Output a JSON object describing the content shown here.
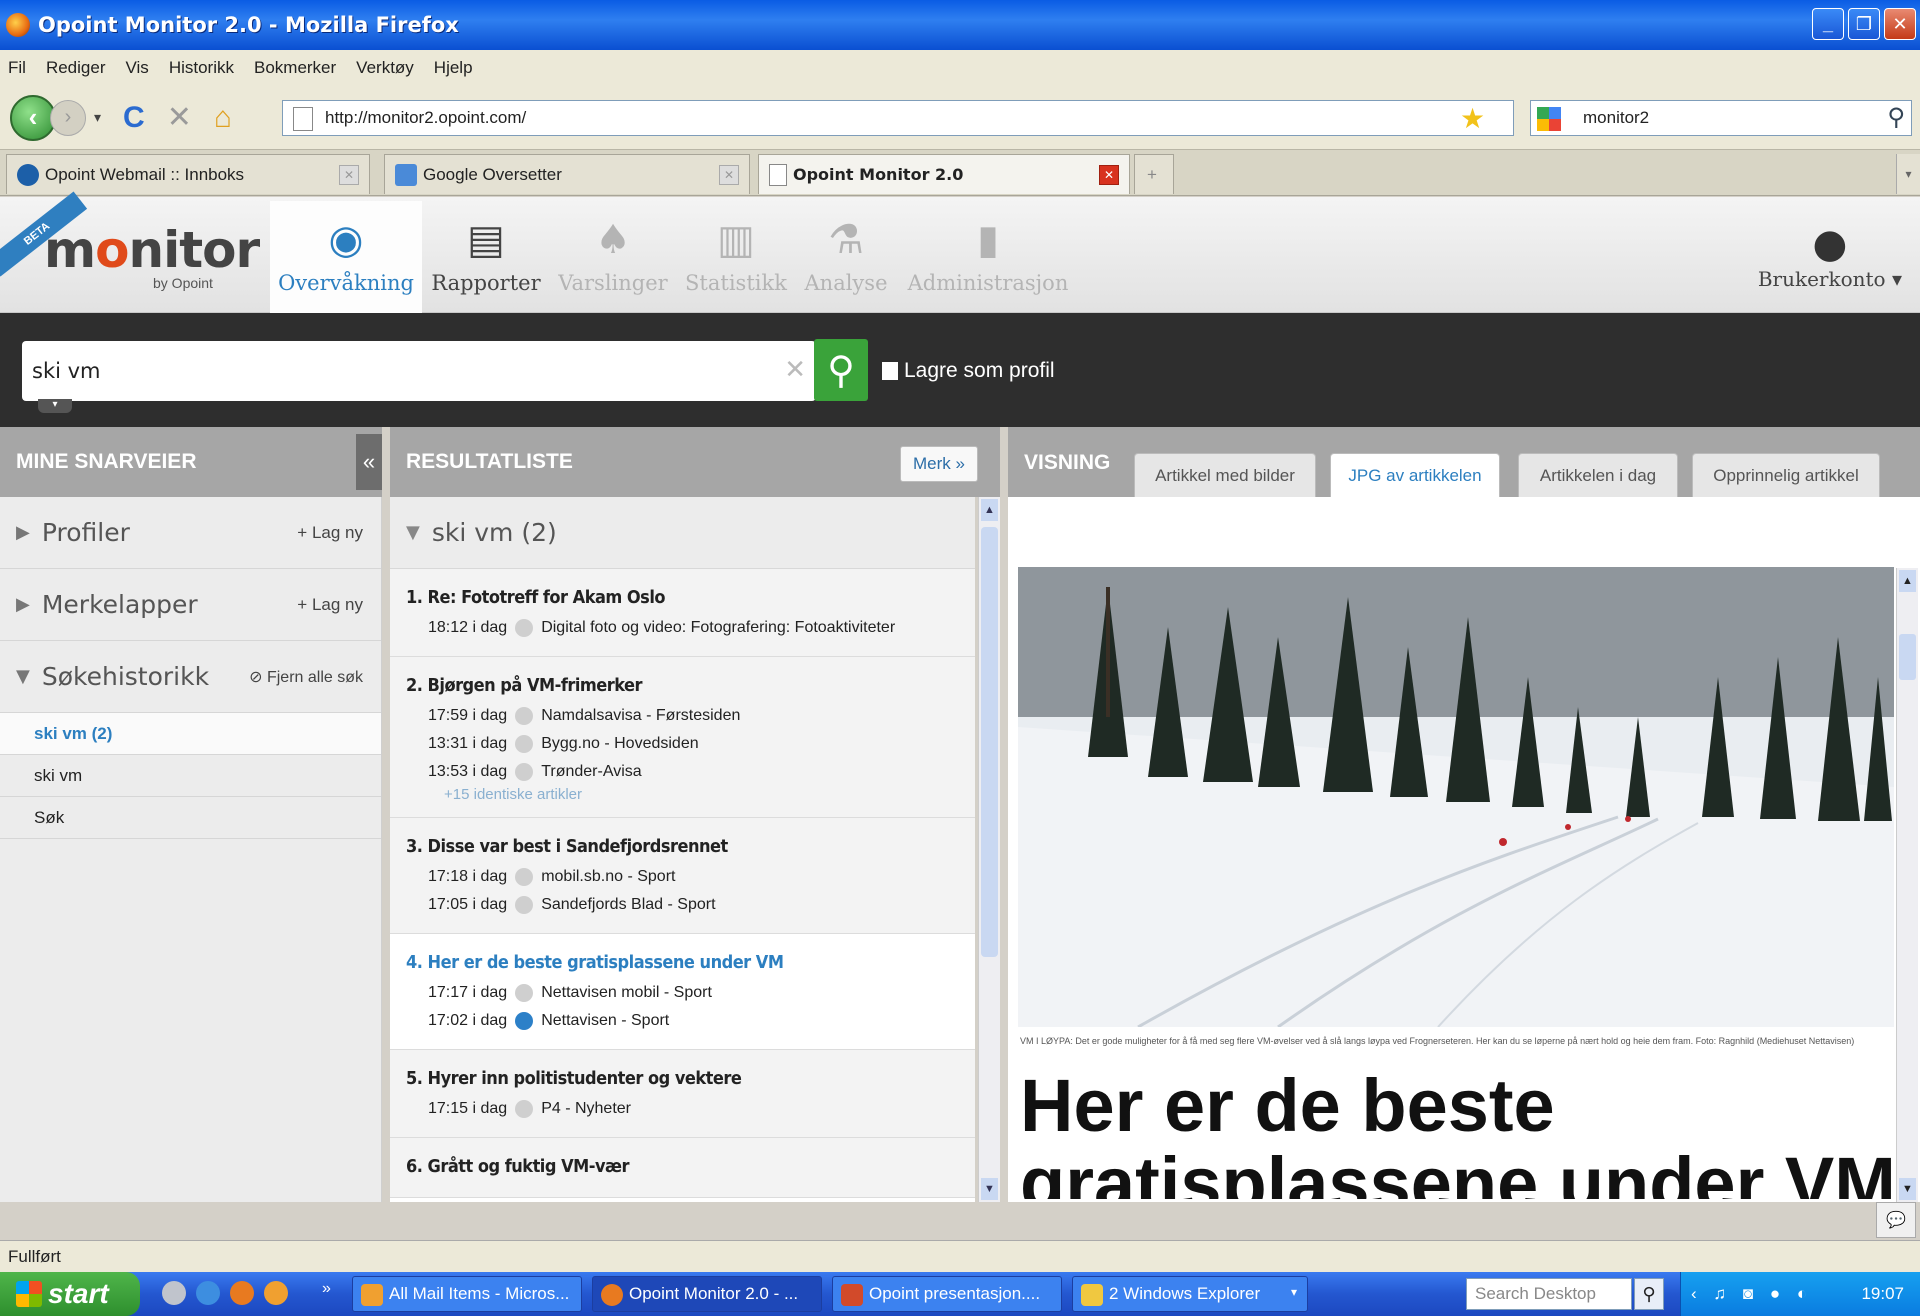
{
  "window": {
    "title": "Opoint Monitor 2.0 - Mozilla Firefox"
  },
  "menu": [
    "Fil",
    "Rediger",
    "Vis",
    "Historikk",
    "Bokmerker",
    "Verktøy",
    "Hjelp"
  ],
  "nav": {
    "url": "http://monitor2.opoint.com/",
    "search_value": "monitor2"
  },
  "browser_tabs": [
    {
      "label": "Opoint Webmail :: Innboks"
    },
    {
      "label": "Google Oversetter"
    },
    {
      "label": "Opoint Monitor 2.0"
    }
  ],
  "app": {
    "beta": "BETA",
    "logo": "monitor",
    "logo_sub": "by Opoint",
    "tabs": [
      "Overvåkning",
      "Rapporter",
      "Varslinger",
      "Statistikk",
      "Analyse",
      "Administrasjon"
    ],
    "account": "Brukerkonto ▾"
  },
  "search": {
    "query": "ski vm",
    "save_label": "Lagre som profil"
  },
  "left": {
    "header": "MINE SNARVEIER",
    "profiler": "Profiler",
    "merkelapper": "Merkelapper",
    "lag_ny": "+ Lag ny",
    "sokehistorikk": "Søkehistorikk",
    "fjern": "Fjern alle søk",
    "history": [
      "ski vm (2)",
      "ski vm",
      "Søk"
    ]
  },
  "results": {
    "header": "RESULTATLISTE",
    "merk": "Merk »",
    "group": "ski vm (2)",
    "articles": [
      {
        "title": "1. Re: Fototreff for Akam Oslo",
        "sources": [
          {
            "time": "18:12 i dag",
            "src": "Digital foto og video: Fotografering: Fotoaktiviteter"
          }
        ]
      },
      {
        "title": "2. Bjørgen på VM-frimerker",
        "sources": [
          {
            "time": "17:59 i dag",
            "src": "Namdalsavisa - Førstesiden"
          },
          {
            "time": "13:31 i dag",
            "src": "Bygg.no - Hovedsiden"
          },
          {
            "time": "13:53 i dag",
            "src": "Trønder-Avisa"
          }
        ],
        "identical": "+15 identiske artikler"
      },
      {
        "title": "3. Disse var best i Sandefjordsrennet",
        "sources": [
          {
            "time": "17:18 i dag",
            "src": "mobil.sb.no - Sport"
          },
          {
            "time": "17:05 i dag",
            "src": "Sandefjords Blad - Sport"
          }
        ]
      },
      {
        "title": "4. Her er de beste gratisplassene under VM",
        "sources": [
          {
            "time": "17:17 i dag",
            "src": "Nettavisen mobil - Sport"
          },
          {
            "time": "17:02 i dag",
            "src": "Nettavisen - Sport"
          }
        ]
      },
      {
        "title": "5. Hyrer inn politistudenter og vektere",
        "sources": [
          {
            "time": "17:15 i dag",
            "src": "P4 - Nyheter"
          }
        ]
      },
      {
        "title": "6. Grått og fuktig VM-vær",
        "sources": []
      }
    ]
  },
  "viewer": {
    "header": "VISNING",
    "tabs": [
      "Artikkel med bilder",
      "JPG av artikkelen",
      "Artikkelen i dag",
      "Opprinnelig artikkel"
    ],
    "caption": "VM I LØYPA: Det er gode muligheter for å få med seg flere VM-øvelser ved å slå langs løypa ved Frognerseteren. Her kan du se løperne på nært hold og heie dem fram. Foto: Ragnhild (Mediehuset Nettavisen)",
    "headline": "Her er de beste gratisplassene under VM"
  },
  "status": "Fullført",
  "taskbar": {
    "start": "start",
    "tasks": [
      "All Mail Items - Micros...",
      "Opoint Monitor 2.0 - ...",
      "Opoint presentasjon....",
      "2 Windows Explorer"
    ],
    "search_placeholder": "Search Desktop",
    "clock": "19:07"
  }
}
